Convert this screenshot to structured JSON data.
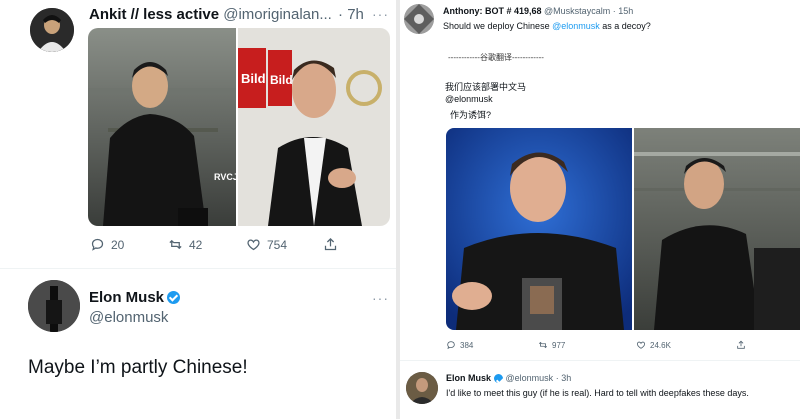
{
  "left": {
    "tweet1": {
      "name": "Ankit // less active",
      "handle": "@imoriginalan...",
      "time": "· 7h",
      "dots": "···",
      "image_badges": [
        "Bild",
        "Bild",
        "RVCJ"
      ],
      "actions": {
        "reply": "20",
        "retweet": "42",
        "like": "754"
      }
    },
    "tweet2": {
      "name": "Elon Musk",
      "handle": "@elonmusk",
      "dots": "···",
      "text": "Maybe I’m partly Chinese!"
    }
  },
  "right": {
    "tweet1": {
      "name": "Anthony: BOT # 419,68",
      "handle": "@Muskstaycalm",
      "time": "· 15h",
      "line1_prefix": "Should we deploy Chinese ",
      "mention": "@elonmusk",
      "line1_suffix": " as a decoy?",
      "translate_label": "------------谷歌翻译------------",
      "cn_line1": "我们应该部署中文马",
      "cn_line2": "@elonmusk",
      "cn_line3": "作为诱饵?",
      "actions": {
        "reply": "384",
        "retweet": "977",
        "like": "24.6K"
      }
    },
    "tweet2": {
      "name": "Elon Musk",
      "handle": "@elonmusk",
      "time": "· 3h",
      "text": "I'd like to meet this guy (if he is real). Hard to tell with deepfakes these days."
    }
  },
  "colors": {
    "accent": "#1d9bf0",
    "text": "#0f1419",
    "muted": "#536471"
  }
}
